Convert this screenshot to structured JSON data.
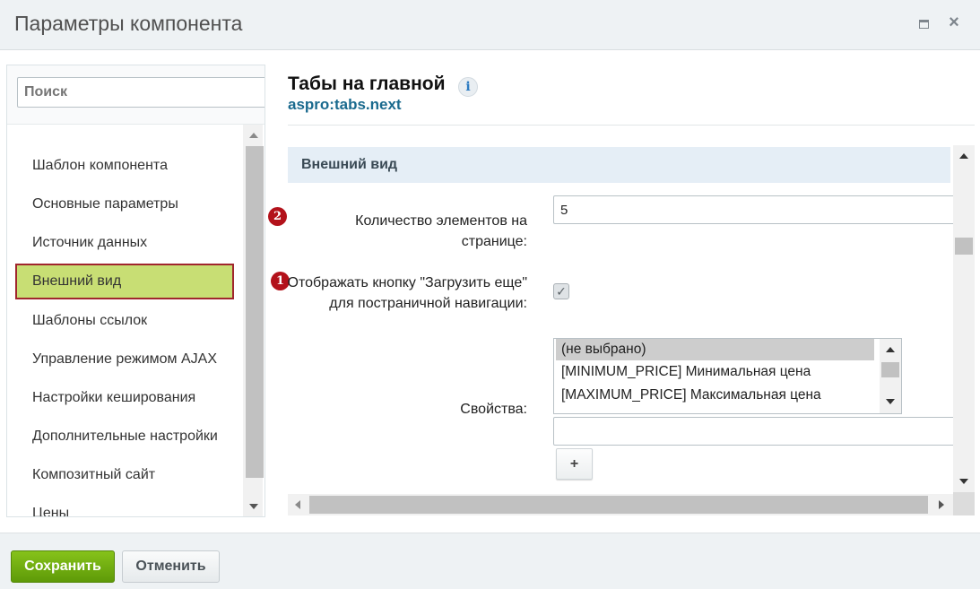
{
  "dialog": {
    "title": "Параметры компонента"
  },
  "sidebar": {
    "search_placeholder": "Поиск",
    "items": [
      {
        "label": "Шаблон компонента"
      },
      {
        "label": "Основные параметры"
      },
      {
        "label": "Источник данных"
      },
      {
        "label": "Внешний вид",
        "active": true
      },
      {
        "label": "Шаблоны ссылок"
      },
      {
        "label": "Управление режимом AJAX"
      },
      {
        "label": "Настройки кеширования"
      },
      {
        "label": "Дополнительные настройки"
      },
      {
        "label": "Композитный сайт"
      },
      {
        "label": "Цены"
      }
    ]
  },
  "component": {
    "title": "Табы на главной",
    "code": "aspro:tabs.next",
    "info_icon": "info-icon"
  },
  "section": {
    "title": "Внешний вид",
    "fields": {
      "page_count": {
        "badge": "2",
        "label": "Количество элементов на странице:",
        "value": "5"
      },
      "load_more": {
        "badge": "1",
        "label_line1": "Отображать кнопку \"Загрузить еще\"",
        "label_line2": "для постраничной навигации:",
        "checked": true
      },
      "properties": {
        "label": "Свойства:",
        "options": [
          "(не выбрано)",
          "[MINIMUM_PRICE] Минимальная цена",
          "[MAXIMUM_PRICE] Максимальная цена"
        ],
        "selected_index": 0,
        "extra_value": "",
        "add_label": "+"
      }
    }
  },
  "footer": {
    "save_label": "Сохранить",
    "cancel_label": "Отменить"
  },
  "colors": {
    "save_button": "#6fae10",
    "active_nav_bg": "#c8de74",
    "active_nav_border": "#a0262d",
    "badge": "#b3121b",
    "component_code": "#1a6a8e",
    "section_head_bg": "#e5eef6"
  }
}
